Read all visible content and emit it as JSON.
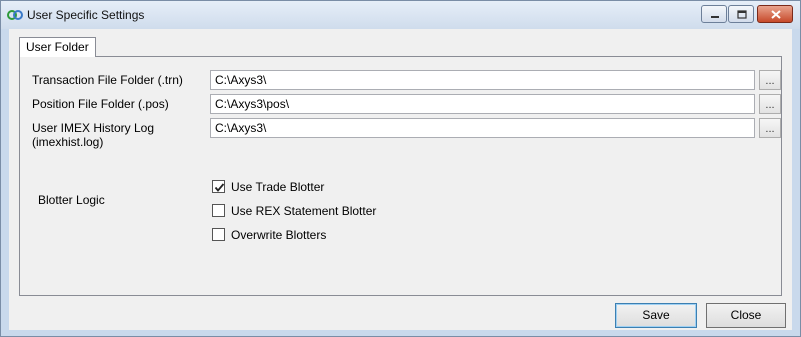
{
  "window": {
    "title": "User Specific Settings"
  },
  "tabs": [
    {
      "label": "User Folder",
      "active": true
    }
  ],
  "fields": [
    {
      "label": "Transaction File Folder (.trn)",
      "value": "C:\\Axys3\\",
      "browse_label": "..."
    },
    {
      "label": "Position File Folder (.pos)",
      "value": "C:\\Axys3\\pos\\",
      "browse_label": "..."
    },
    {
      "label": "User IMEX History Log (imexhist.log)",
      "value": "C:\\Axys3\\",
      "browse_label": "..."
    }
  ],
  "blotter": {
    "label": "Blotter Logic",
    "options": [
      {
        "label": "Use Trade Blotter",
        "checked": true
      },
      {
        "label": "Use REX Statement Blotter",
        "checked": false
      },
      {
        "label": "Overwrite Blotters",
        "checked": false
      }
    ]
  },
  "buttons": {
    "save_label": "Save",
    "close_label": "Close"
  },
  "colors": {
    "titlebar": "#cfdcec",
    "close_button": "#c74a2b",
    "app_icon": "#2e9a3a"
  },
  "icons": {
    "app": "app-logo-icon",
    "minimize": "minimize-icon",
    "maximize": "maximize-icon",
    "close": "close-icon",
    "check": "checkmark-icon"
  }
}
